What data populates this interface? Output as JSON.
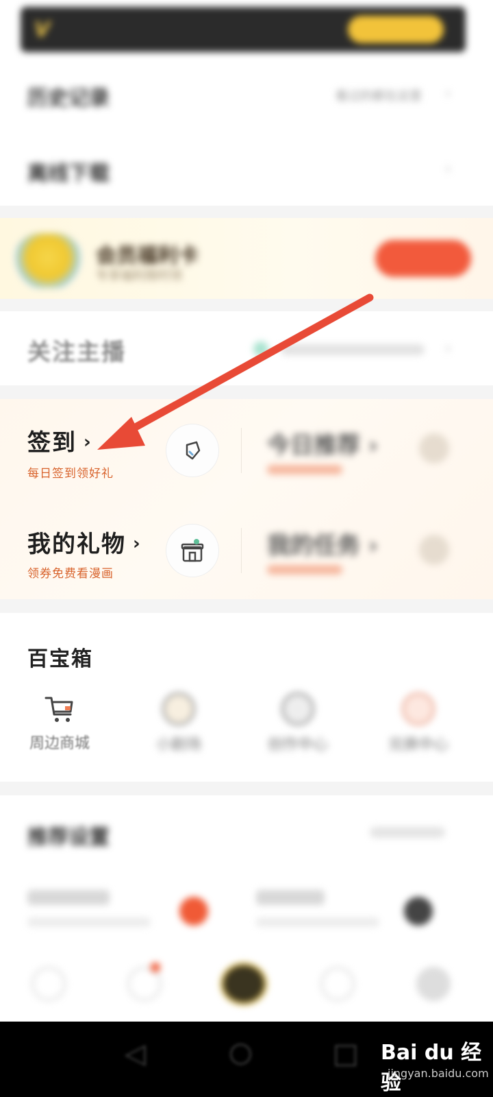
{
  "colors": {
    "accent_orange": "#d8622b",
    "arrow_red": "#e84a36",
    "vip_gold": "#f2c33a",
    "dark": "#1e1e1e"
  },
  "blurred_rows": {
    "row1_title": "历史记录",
    "row1_right": "看过的都在这里",
    "row2_title": "离线下载"
  },
  "promo": {
    "title": "会员福利卡",
    "subtitle": "专享福利限时领"
  },
  "follow": {
    "title": "关注主播"
  },
  "features": [
    {
      "title": "签到",
      "subtitle": "每日签到领好礼",
      "icon": "pen-icon"
    },
    {
      "title": "我的礼物",
      "subtitle": "领券免费看漫画",
      "icon": "gift-shop-icon"
    }
  ],
  "treasure_box": {
    "title": "百宝箱",
    "tools": [
      {
        "label": "周边商城",
        "icon": "shopping-cart-icon"
      },
      {
        "label": "小剧场",
        "icon": "duck-face-icon"
      },
      {
        "label": "创作中心",
        "icon": "creator-icon"
      },
      {
        "label": "兑换中心",
        "icon": "exchange-icon"
      }
    ]
  },
  "recommend": {
    "title": "推荐设置"
  },
  "watermark": {
    "brand": "Bai du 经验",
    "url": "jingyan.baidu.com"
  }
}
